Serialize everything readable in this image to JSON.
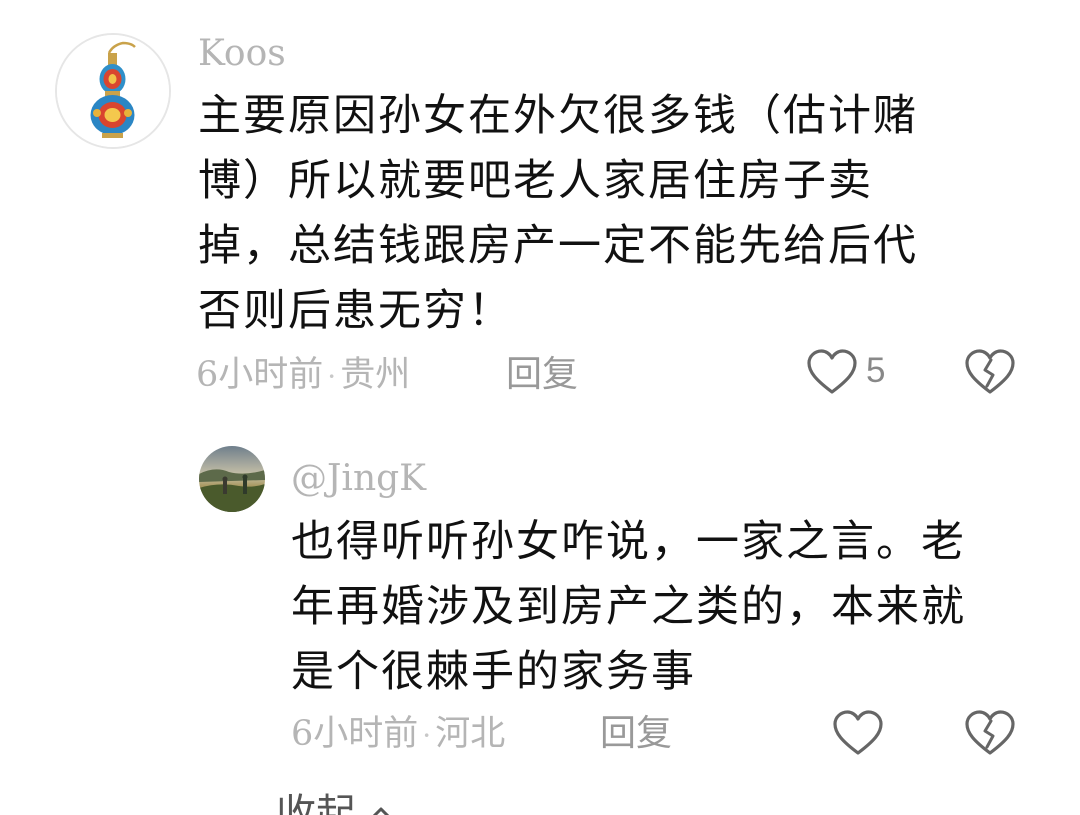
{
  "comments": [
    {
      "username": "Koos",
      "text_lines": [
        "主要原因孙女在外欠很多钱（估计赌",
        "博）所以就要吧老人家居住房子卖",
        "掉，总结钱跟房产一定不能先给后代",
        "否则后患无穷！"
      ],
      "time": "6小时前",
      "location": "贵州",
      "reply_label": "回复",
      "like_count": "5",
      "avatar_icon": "gourd-vase-icon"
    }
  ],
  "replies": [
    {
      "username": "@JingK",
      "text_lines": [
        "也得听听孙女咋说，一家之言。老",
        "年再婚涉及到房产之类的，本来就",
        "是个很棘手的家务事"
      ],
      "time": "6小时前",
      "location": "河北",
      "reply_label": "回复",
      "avatar_icon": "landscape-photo-icon"
    }
  ],
  "collapse_label": "收起",
  "separator": "·",
  "colors": {
    "meta_text": "#b5b5b5",
    "body_text": "#111111",
    "icon_stroke": "#666666"
  }
}
